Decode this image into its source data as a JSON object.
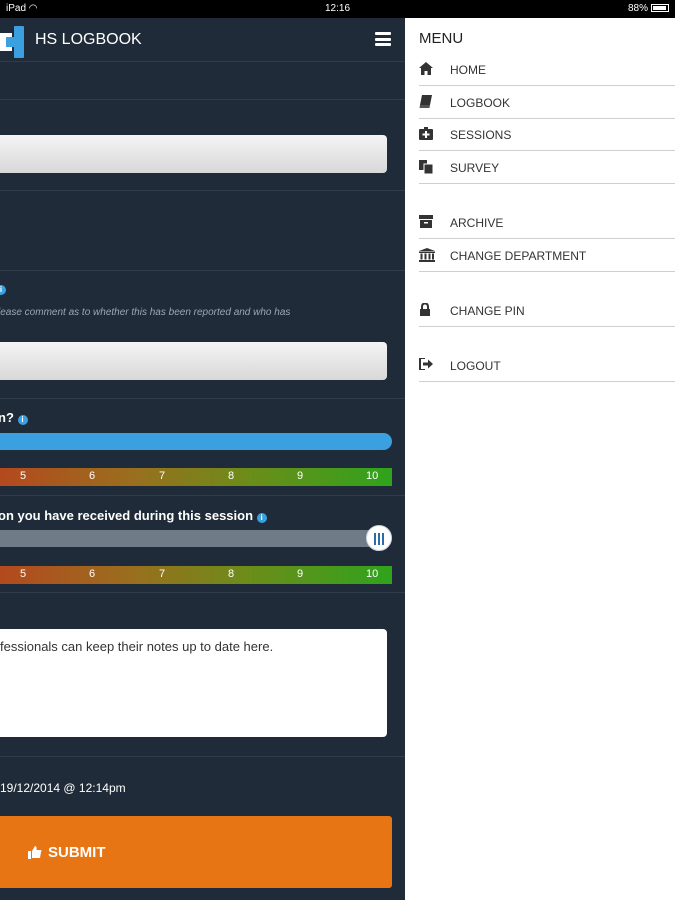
{
  "status_bar": {
    "device": "iPad",
    "time": "12:16",
    "battery": "88%"
  },
  "header": {
    "app_title": "HS LOGBOOK"
  },
  "form": {
    "hint_text": "lease comment as to whether this has been reported and who has",
    "question_1": "n?",
    "question_2": "on you have received during this session",
    "scale_labels": [
      "5",
      "6",
      "7",
      "8",
      "9",
      "10"
    ],
    "slider_1_value": 10,
    "slider_2_value": 10,
    "notes_text": "fessionals can keep their notes up to date here.",
    "date_text": "19/12/2014 @ 12:14pm",
    "submit_label": "SUBMIT"
  },
  "menu": {
    "title": "MENU",
    "items": [
      {
        "label": "HOME",
        "icon": "home-icon"
      },
      {
        "label": "LOGBOOK",
        "icon": "book-icon"
      },
      {
        "label": "SESSIONS",
        "icon": "medkit-icon"
      },
      {
        "label": "SURVEY",
        "icon": "copy-icon"
      },
      {
        "label": "ARCHIVE",
        "icon": "archive-icon"
      },
      {
        "label": "CHANGE DEPARTMENT",
        "icon": "institution-icon"
      },
      {
        "label": "CHANGE PIN",
        "icon": "lock-icon"
      },
      {
        "label": "LOGOUT",
        "icon": "sign-out-icon"
      }
    ]
  },
  "colors": {
    "panel_bg": "#1f2b38",
    "accent_blue": "#3aa0e0",
    "submit_orange": "#e87513"
  }
}
